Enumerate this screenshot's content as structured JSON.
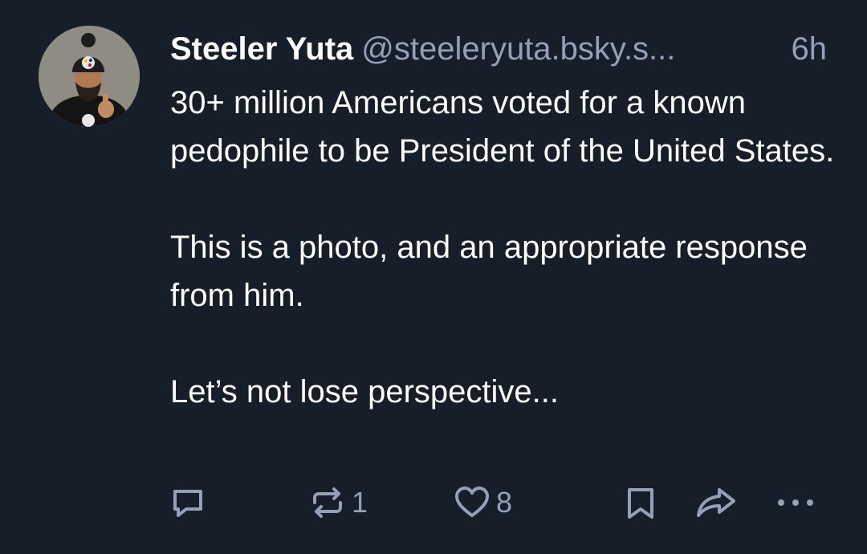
{
  "post": {
    "author_name": "Steeler Yuta",
    "handle": "@steeleryuta.bsky.s...",
    "timestamp": "6h",
    "paragraphs": [
      "30+ million Americans voted for a known pedophile to be President of the United States.",
      "This is a photo, and an appropriate response from him.",
      "Let’s not lose perspective..."
    ]
  },
  "actions": {
    "reply_count": "",
    "repost_count": "1",
    "like_count": "8"
  },
  "colors": {
    "background": "#161e29",
    "text": "#ffffff",
    "muted": "#93a0b5"
  },
  "icons": [
    "reply-icon",
    "repost-icon",
    "like-icon",
    "bookmark-icon",
    "share-icon",
    "more-icon"
  ]
}
